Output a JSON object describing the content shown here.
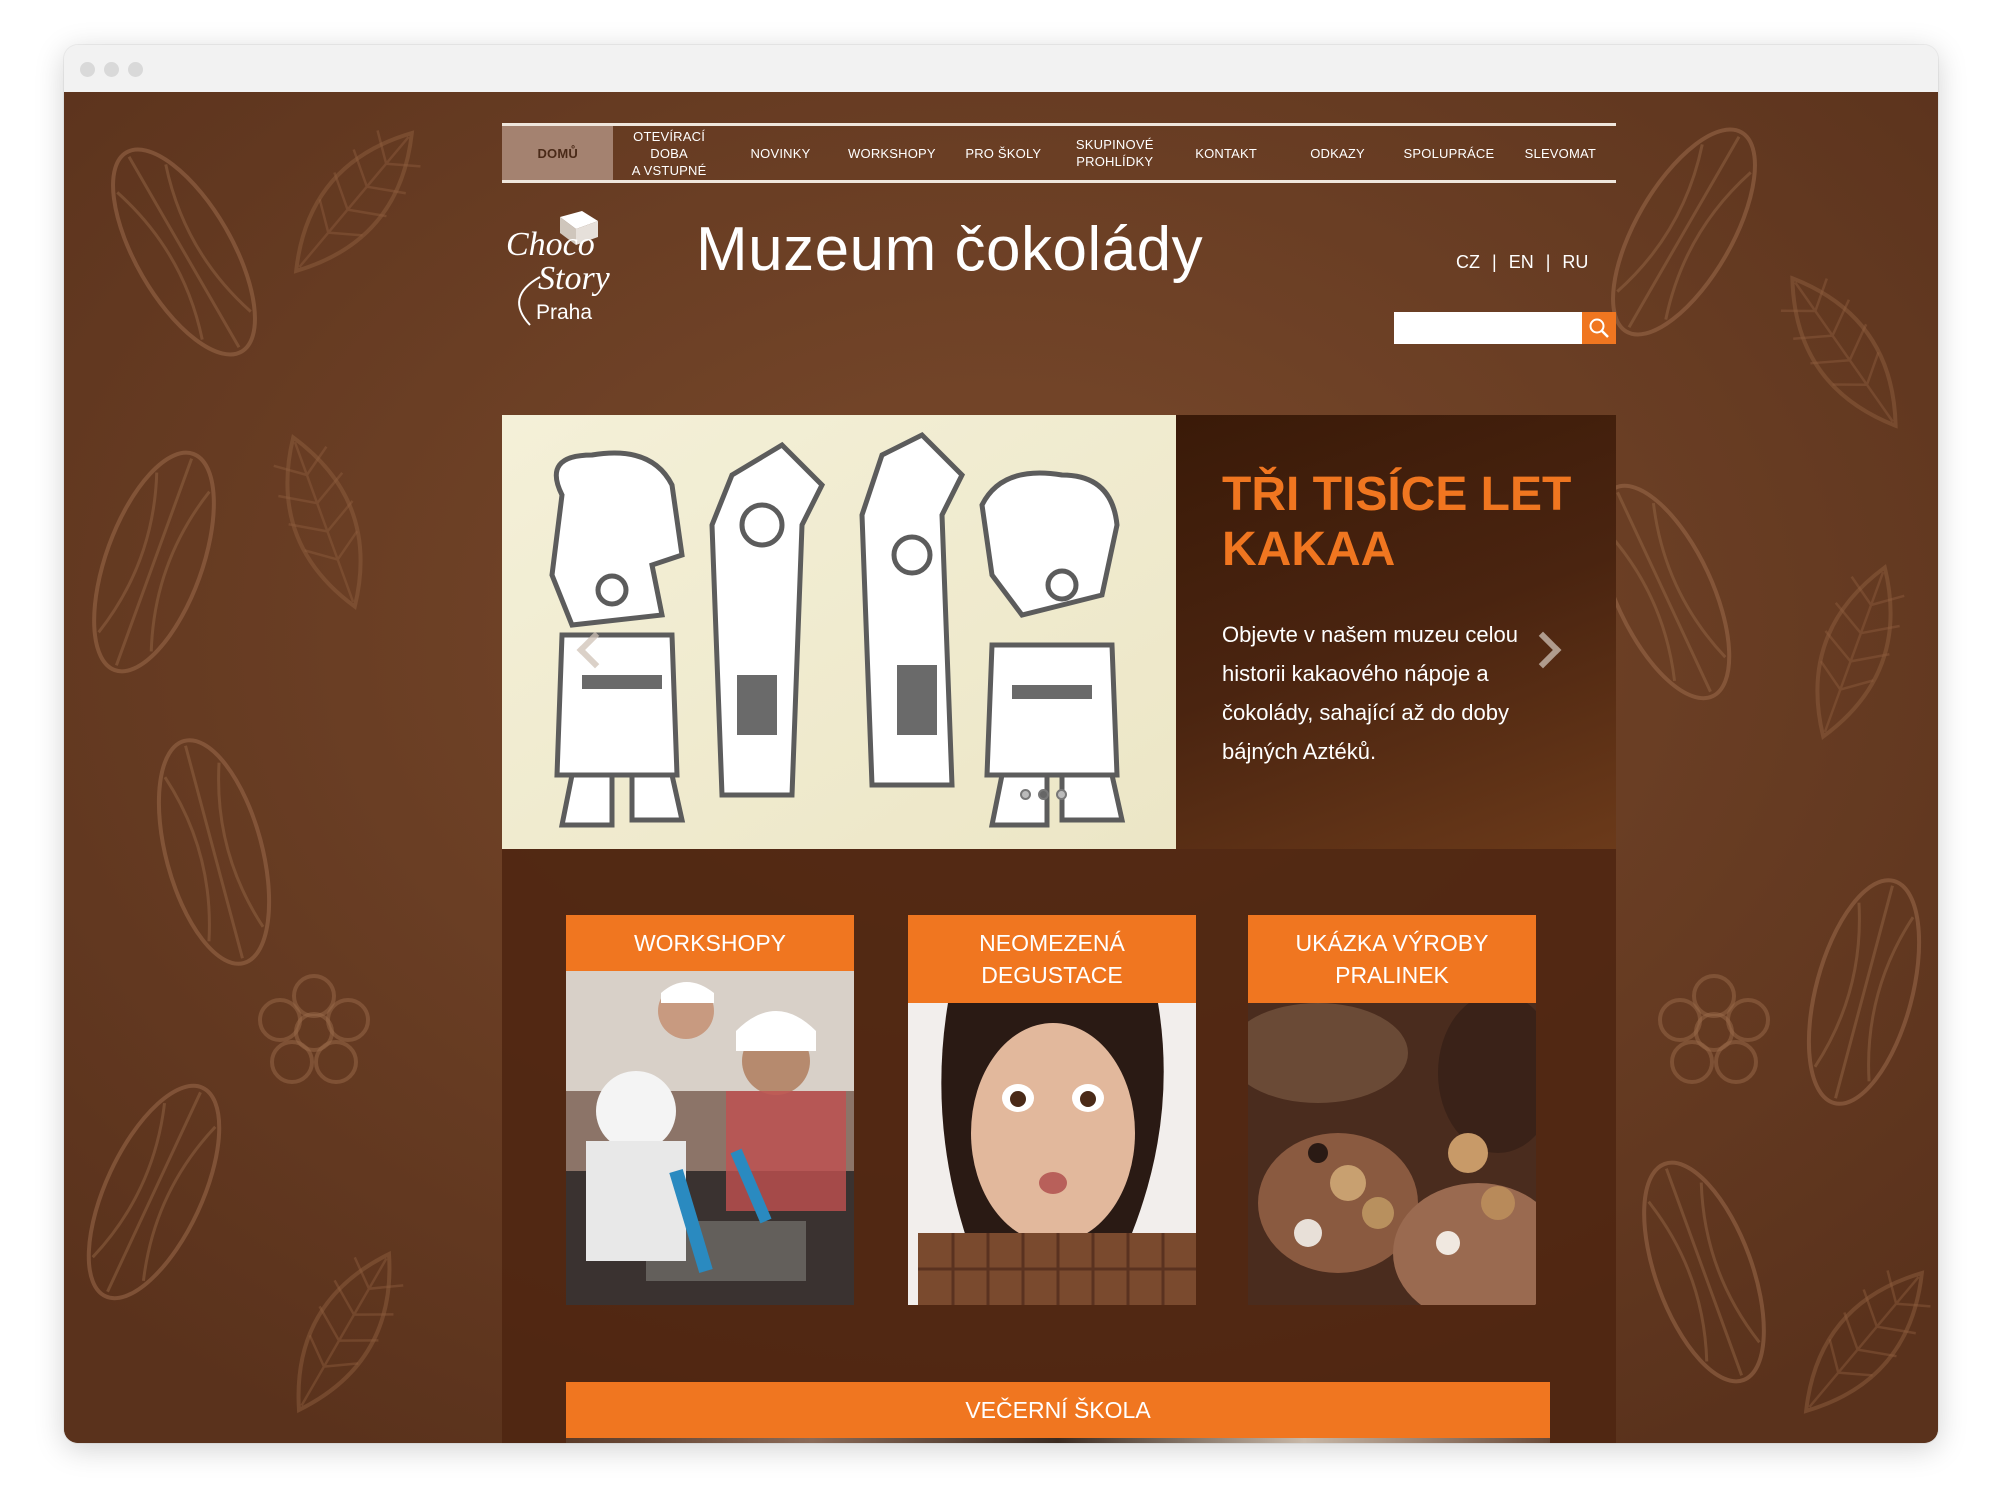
{
  "nav": {
    "items": [
      {
        "label": "DOMŮ",
        "active": true
      },
      {
        "label": "OTEVÍRACÍ DOBA\nA VSTUPNÉ"
      },
      {
        "label": "NOVINKY"
      },
      {
        "label": "WORKSHOPY"
      },
      {
        "label": "PRO ŠKOLY"
      },
      {
        "label": "SKUPINOVÉ\nPROHLÍDKY"
      },
      {
        "label": "KONTAKT"
      },
      {
        "label": "ODKAZY"
      },
      {
        "label": "SPOLUPRÁCE"
      },
      {
        "label": "SLEVOMAT"
      }
    ]
  },
  "logo": {
    "line1": "Choco",
    "line2": "Story",
    "line3": "Praha"
  },
  "header": {
    "title": "Muzeum čokolády"
  },
  "langs": {
    "items": [
      "CZ",
      "EN",
      "RU"
    ],
    "separator": "|"
  },
  "search": {
    "placeholder": "",
    "value": "",
    "icon": "search-icon"
  },
  "slider": {
    "title": "TŘI TISÍCE LET KAKAA",
    "description": "Objevte v našem muzeu celou historii kakaového nápoje a čokolády, sahající až do doby bájných Aztéků.",
    "dots": 3,
    "active_dot": 2
  },
  "cards": [
    {
      "title": "WORKSHOPY"
    },
    {
      "title": "NEOMEZENÁ\nDEGUSTACE"
    },
    {
      "title": "UKÁZKA VÝROBY\nPRALINEK"
    }
  ],
  "evening": {
    "title": "VEČERNÍ ŠKOLA"
  },
  "colors": {
    "accent": "#f07620",
    "panel": "#4e2611",
    "background": "#6b3e24"
  }
}
